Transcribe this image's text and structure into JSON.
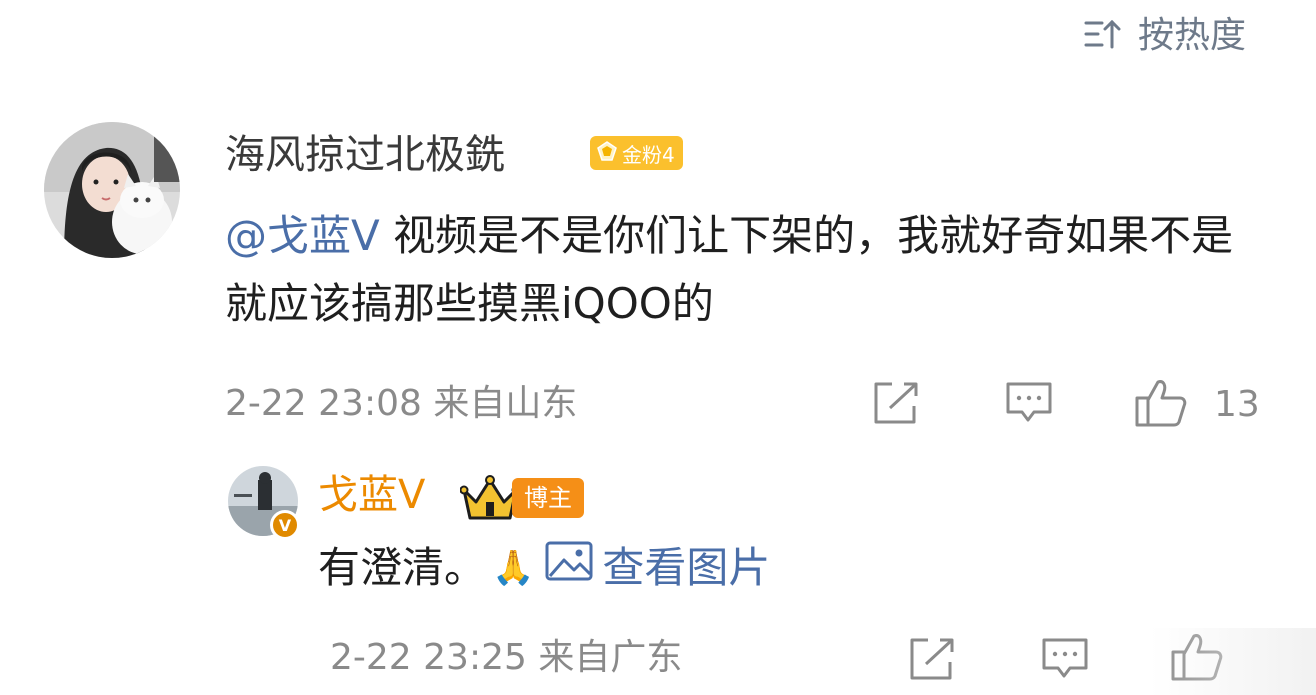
{
  "sort": {
    "label": "按热度",
    "icon": "sort-icon"
  },
  "comment": {
    "author": "海风掠过北极銑",
    "fan_badge": "金粉4",
    "mention": "@戈蓝V",
    "text_rest": " 视频是不是你们让下架的，我就好奇如果不是就应该搞那些摸黑iQOO的",
    "time_location": "2-22 23:08 来自山东",
    "likes": "13"
  },
  "reply": {
    "author": "戈蓝V",
    "role_badge": "博主",
    "text": "有澄清。",
    "emoji": "🙏",
    "image_link": "查看图片",
    "time_location": "2-22 23:25 来自广东"
  },
  "colors": {
    "link": "#4a6ea8",
    "blogger_orange": "#ec8a00",
    "fan_badge_bg": "#fbc02d",
    "meta_gray": "#8a8a8a"
  }
}
